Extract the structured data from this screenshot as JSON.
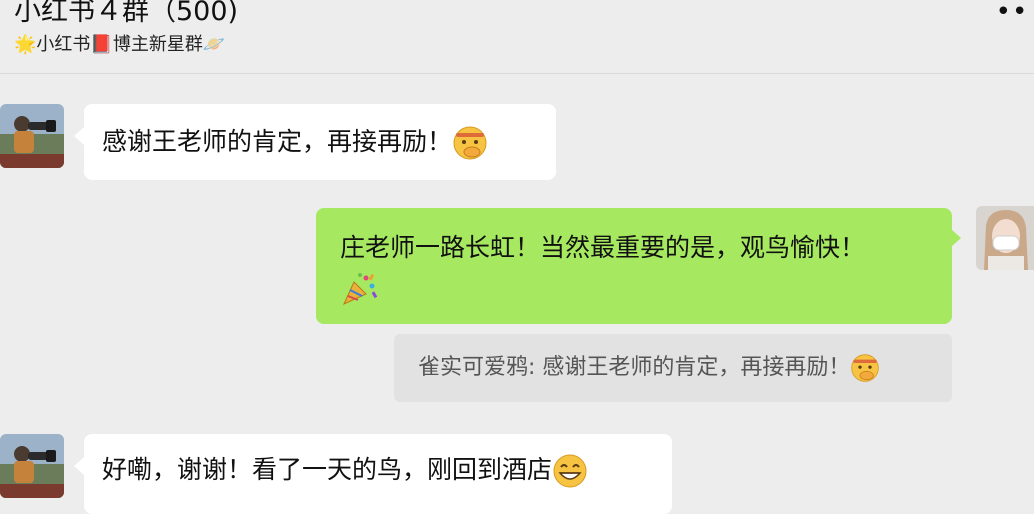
{
  "header": {
    "title": "小红书４群（500)",
    "subtitle_prefix": "🌟",
    "subtitle_text_1": "小红书",
    "subtitle_book": "📕",
    "subtitle_text_2": "博主新星群",
    "subtitle_suffix": "🪐",
    "more_label": "••"
  },
  "messages": [
    {
      "side": "left",
      "text": "感谢王老师的肯定，再接再励！",
      "emoji": "face-with-hand-over-mouth"
    },
    {
      "side": "right",
      "text": "庄老师一路长虹！当然最重要的是，观鸟愉快！",
      "emoji": "party-popper"
    },
    {
      "side": "right",
      "type": "quote",
      "sender": "雀实可爱鸦",
      "text": "雀实可爱鸦: 感谢王老师的肯定，再接再励！",
      "emoji": "face-with-hand-over-mouth"
    },
    {
      "side": "left",
      "text": "好嘞，谢谢！看了一天的鸟，刚回到酒店",
      "emoji": "grinning-face"
    }
  ],
  "colors": {
    "background": "#ededed",
    "incoming_bubble": "#ffffff",
    "outgoing_bubble": "#a6e860",
    "quote_bubble": "#e2e2e2"
  }
}
